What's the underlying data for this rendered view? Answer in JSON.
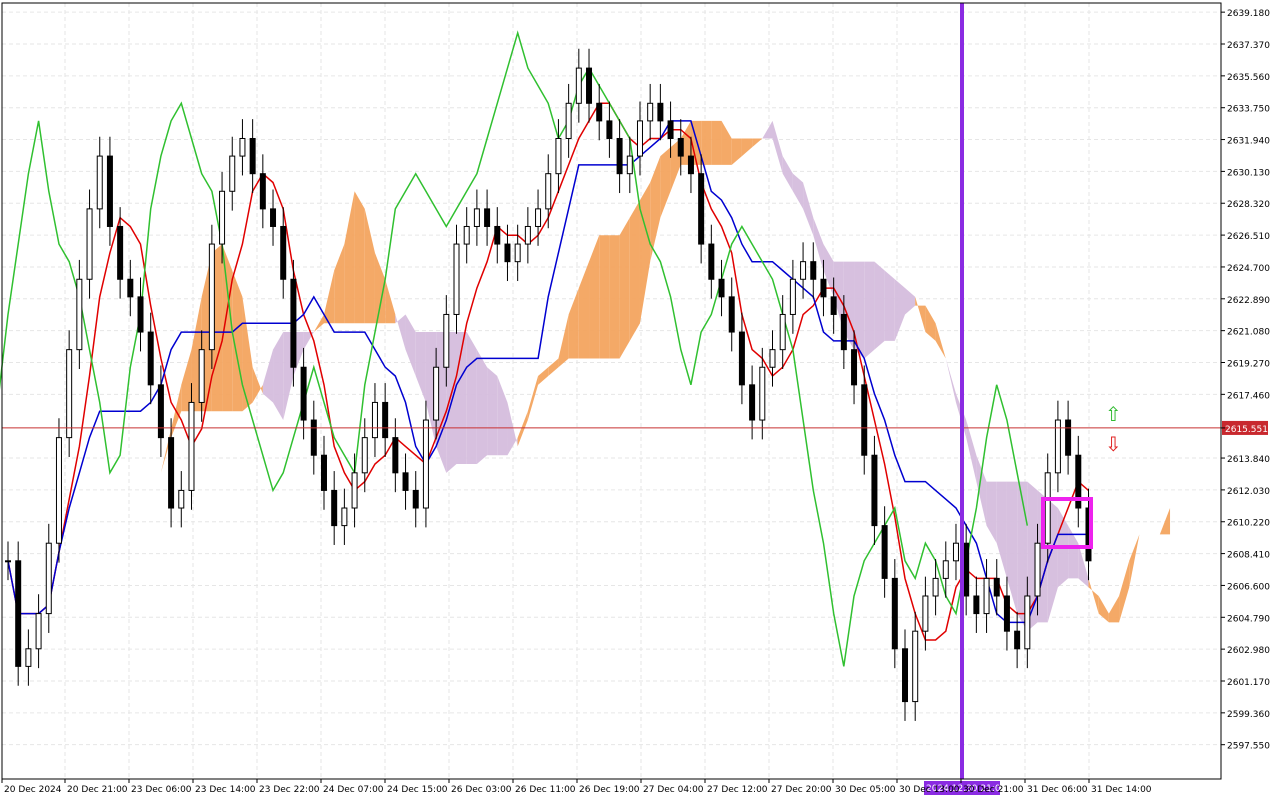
{
  "chart_data": {
    "type": "candlestick",
    "instrument_note": "",
    "x_ticks": [
      "20 Dec 2024",
      "20 Dec 21:00",
      "23 Dec 06:00",
      "23 Dec 14:00",
      "23 Dec 22:00",
      "24 Dec 07:00",
      "24 Dec 15:00",
      "26 Dec 03:00",
      "26 Dec 11:00",
      "26 Dec 19:00",
      "27 Dec 04:00",
      "27 Dec 12:00",
      "27 Dec 20:00",
      "30 Dec 05:00",
      "30 Dec 13:00",
      "30 Dec 21:00",
      "31 Dec 06:00",
      "31 Dec 14:00"
    ],
    "y_ticks": [
      2639.18,
      2637.37,
      2635.56,
      2633.75,
      2631.94,
      2630.13,
      2628.32,
      2626.51,
      2624.7,
      2622.89,
      2621.08,
      2619.27,
      2617.46,
      2615.551,
      2613.84,
      2612.03,
      2610.22,
      2608.41,
      2606.6,
      2604.79,
      2602.98,
      2601.17,
      2599.36,
      2597.55
    ],
    "y_tick_labels": [
      "2639.180",
      "2637.370",
      "2635.560",
      "2633.750",
      "2631.940",
      "2630.130",
      "2628.320",
      "2626.510",
      "2624.700",
      "2622.890",
      "2621.080",
      "2619.270",
      "2617.460",
      "2615.551",
      "2613.840",
      "2612.030",
      "2610.220",
      "2608.410",
      "2606.600",
      "2604.790",
      "2602.980",
      "2601.170",
      "2599.360",
      "2597.550"
    ],
    "ylim": [
      2595.6,
      2639.7
    ],
    "current_price": 2615.551,
    "current_price_label": "2615.551",
    "vline_label": "2024.12.30 21:00",
    "colors": {
      "tenkan": "#e00000",
      "kijun": "#0000d0",
      "chikou": "#30c030",
      "cloud_bull": "#f3a45f",
      "cloud_bear": "#d5bddd",
      "vline": "#8a2be2",
      "highlight_box": "#ee22ee",
      "price_line": "#c83030",
      "price_label_bg": "#c8282e"
    },
    "series": [
      {
        "name": "",
        "points": [
          2608,
          2602,
          2603,
          2605,
          2609,
          2615,
          2620,
          2624,
          2628,
          2631,
          2627,
          2624,
          2623,
          2621,
          2618,
          2615,
          2611,
          2612,
          2617,
          2620,
          2626,
          2629,
          2631,
          2632,
          2630,
          2628,
          2627,
          2624,
          2619,
          2616,
          2614,
          2612,
          2610,
          2611,
          2613,
          2615,
          2617,
          2615,
          2613,
          2612,
          2611,
          2616,
          2619,
          2622,
          2626,
          2627,
          2628,
          2627,
          2626,
          2625,
          2626,
          2627,
          2628,
          2630,
          2632,
          2634,
          2636,
          2634,
          2633,
          2632,
          2630,
          2631,
          2633,
          2634,
          2633,
          2632,
          2631,
          2630,
          2626,
          2624,
          2623,
          2621,
          2618,
          2616,
          2619,
          2620,
          2622,
          2624,
          2625,
          2624,
          2623,
          2622,
          2620,
          2618,
          2614,
          2610,
          2607,
          2603,
          2600,
          2604,
          2606,
          2607,
          2608,
          2609,
          2606,
          2605,
          2607,
          2606,
          2604,
          2603,
          2606,
          2609,
          2613,
          2616,
          2614,
          2611,
          2608
        ]
      },
      {
        "name": "",
        "points": []
      }
    ],
    "arrow_up_label": "⇧",
    "arrow_down_label": "⇩"
  }
}
